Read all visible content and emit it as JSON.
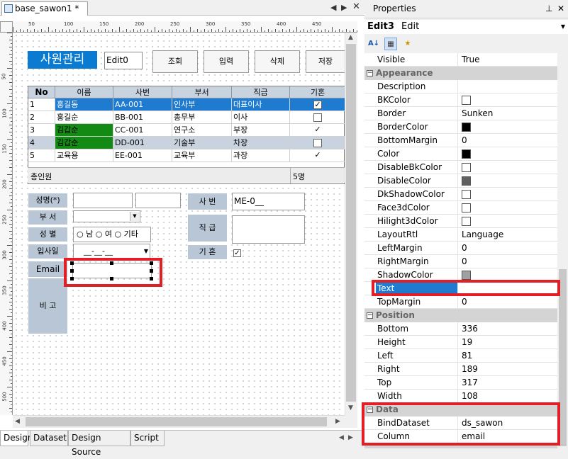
{
  "document_tab": {
    "title": "base_sawon1 *"
  },
  "form": {
    "title": "사원관리",
    "edit0": "Edit0",
    "buttons": [
      "조회",
      "입력",
      "삭제",
      "저장"
    ],
    "grid": {
      "columns": [
        "No",
        "이름",
        "사번",
        "부서",
        "직급",
        "기혼"
      ],
      "rows": [
        {
          "no": "1",
          "name": "홍길동",
          "id": "AA-001",
          "dept": "인사부",
          "rank": "대표이사",
          "married": true
        },
        {
          "no": "2",
          "name": "홍길순",
          "id": "BB-001",
          "dept": "총무부",
          "rank": "이사",
          "married": false
        },
        {
          "no": "3",
          "name": "김갑순",
          "id": "CC-001",
          "dept": "연구소",
          "rank": "부장",
          "married": true
        },
        {
          "no": "4",
          "name": "김갑순",
          "id": "DD-001",
          "dept": "기술부",
          "rank": "차장",
          "married": false
        },
        {
          "no": "5",
          "name": "교육용",
          "id": "EE-001",
          "dept": "교육부",
          "rank": "과장",
          "married": true
        }
      ],
      "footer_left": "총인원",
      "footer_right": "5명"
    },
    "labels": {
      "name": "성명(*)",
      "dept": "부 서",
      "gender": "성 별",
      "hire": "입사일",
      "email": "Email",
      "note": "비 고",
      "emp_no": "사 번",
      "rank": "직 급",
      "married": "기 혼"
    },
    "gender_options": [
      "남",
      "여",
      "기타"
    ],
    "hire_mask": "__-__-__",
    "emp_no_value": "ME-0__"
  },
  "bottom_tabs": [
    "Design",
    "Dataset",
    "Design Source",
    "Script"
  ],
  "properties": {
    "header": "Properties",
    "pin_icon": "pin-icon",
    "close_icon": "close-icon",
    "object_name": "Edit3",
    "object_type": "Edit",
    "rows_top": [
      {
        "name": "Visible",
        "value": "True"
      }
    ],
    "appearance": {
      "label": "Appearance",
      "rows": [
        {
          "name": "Description",
          "value": ""
        },
        {
          "name": "BKColor",
          "value": "",
          "swatch": "#ffffff"
        },
        {
          "name": "Border",
          "value": "Sunken"
        },
        {
          "name": "BorderColor",
          "value": "",
          "swatch": "#000000"
        },
        {
          "name": "BottomMargin",
          "value": "0"
        },
        {
          "name": "Color",
          "value": "",
          "swatch": "#000000"
        },
        {
          "name": "DisableBkColor",
          "value": "",
          "swatch": "#ffffff"
        },
        {
          "name": "DisableColor",
          "value": "",
          "swatch": "#606060"
        },
        {
          "name": "DkShadowColor",
          "value": "",
          "swatch": "#ffffff"
        },
        {
          "name": "Face3dColor",
          "value": "",
          "swatch": "#ffffff"
        },
        {
          "name": "Hilight3dColor",
          "value": "",
          "swatch": "#ffffff"
        },
        {
          "name": "LayoutRtl",
          "value": "Language"
        },
        {
          "name": "LeftMargin",
          "value": "0"
        },
        {
          "name": "RightMargin",
          "value": "0"
        },
        {
          "name": "ShadowColor",
          "value": "",
          "swatch": "#a0a0a0"
        },
        {
          "name": "Text",
          "value": "",
          "selected": true
        },
        {
          "name": "TopMargin",
          "value": "0"
        }
      ]
    },
    "position": {
      "label": "Position",
      "rows": [
        {
          "name": "Bottom",
          "value": "336"
        },
        {
          "name": "Height",
          "value": "19"
        },
        {
          "name": "Left",
          "value": "81"
        },
        {
          "name": "Right",
          "value": "189"
        },
        {
          "name": "Top",
          "value": "317"
        },
        {
          "name": "Width",
          "value": "108"
        }
      ]
    },
    "data_cat": {
      "label": "Data",
      "rows": [
        {
          "name": "BindDataset",
          "value": "ds_sawon"
        },
        {
          "name": "Column",
          "value": "email"
        }
      ]
    }
  },
  "colors": {
    "accent": "#0a7bd1",
    "highlight_red": "#e01f26",
    "grid_green": "#138a13",
    "selected_row": "#1f7bd0"
  }
}
